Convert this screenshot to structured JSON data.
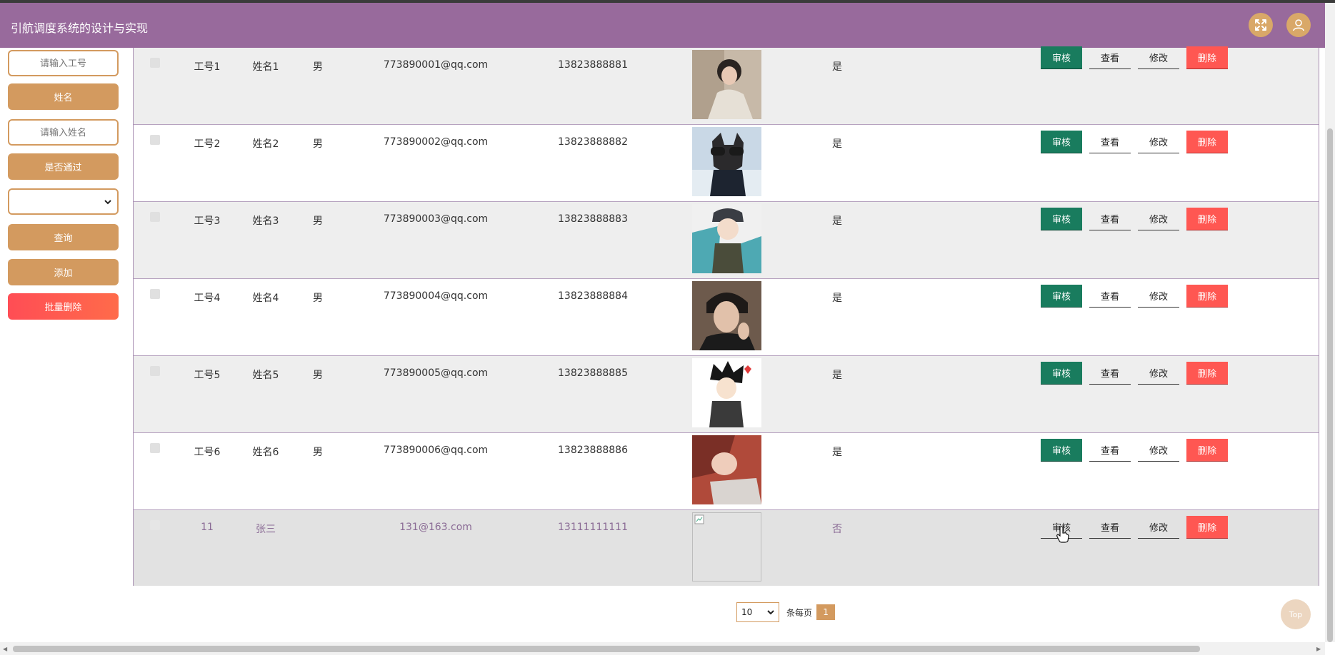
{
  "header": {
    "title": "引航调度系统的设计与实现",
    "fullscreen_icon": "fullscreen-icon",
    "user_icon": "user-icon"
  },
  "sidebar": {
    "employee_no_placeholder": "请输入工号",
    "name_label": "姓名",
    "name_placeholder": "请输入姓名",
    "passed_label": "是否通过",
    "passed_value": "",
    "search_button": "查询",
    "add_button": "添加",
    "batch_delete_button": "批量删除"
  },
  "table": {
    "actions": {
      "audit": "审核",
      "view": "查看",
      "edit": "修改",
      "delete": "删除"
    },
    "rows": [
      {
        "emp_no": "工号1",
        "name": "姓名1",
        "gender": "男",
        "email": "773890001@qq.com",
        "phone": "13823888881",
        "passed": "是",
        "photo": "portrait-girl"
      },
      {
        "emp_no": "工号2",
        "name": "姓名2",
        "gender": "男",
        "email": "773890002@qq.com",
        "phone": "13823888882",
        "passed": "是",
        "photo": "dog-with-sunglasses"
      },
      {
        "emp_no": "工号3",
        "name": "姓名3",
        "gender": "男",
        "email": "773890003@qq.com",
        "phone": "13823888883",
        "passed": "是",
        "photo": "anime-boy-cap"
      },
      {
        "emp_no": "工号4",
        "name": "姓名4",
        "gender": "男",
        "email": "773890004@qq.com",
        "phone": "13823888884",
        "passed": "是",
        "photo": "portrait-boy"
      },
      {
        "emp_no": "工号5",
        "name": "姓名5",
        "gender": "男",
        "email": "773890005@qq.com",
        "phone": "13823888885",
        "passed": "是",
        "photo": "cartoon-boy"
      },
      {
        "emp_no": "工号6",
        "name": "姓名6",
        "gender": "男",
        "email": "773890006@qq.com",
        "phone": "13823888886",
        "passed": "是",
        "photo": "portrait-woman"
      },
      {
        "emp_no": "11",
        "name": "张三",
        "gender": "",
        "email": "131@163.com",
        "phone": "13111111111",
        "passed": "否",
        "photo": "broken-image"
      }
    ]
  },
  "pagination": {
    "page_size": "10",
    "per_page_label": "条每页",
    "current_page": "1"
  },
  "back_to_top": "Top",
  "colors": {
    "header": "#986a9c",
    "accent": "#d39a5f",
    "audit": "#197c5e",
    "delete": "#ff5752"
  }
}
